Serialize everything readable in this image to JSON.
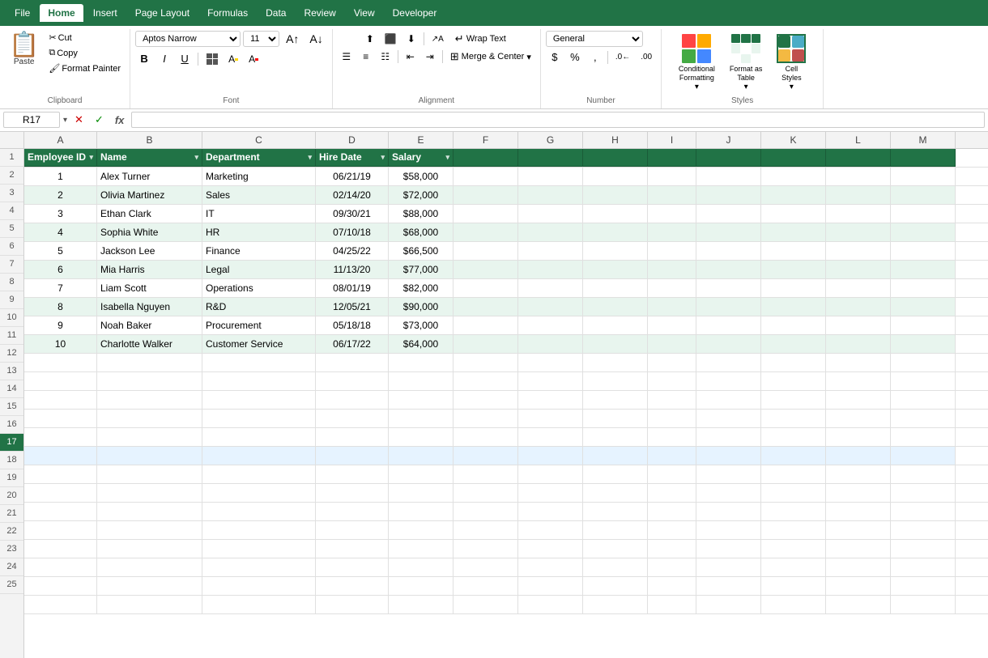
{
  "tabs": {
    "items": [
      {
        "label": "File",
        "active": false
      },
      {
        "label": "Home",
        "active": true
      },
      {
        "label": "Insert",
        "active": false
      },
      {
        "label": "Page Layout",
        "active": false
      },
      {
        "label": "Formulas",
        "active": false
      },
      {
        "label": "Data",
        "active": false
      },
      {
        "label": "Review",
        "active": false
      },
      {
        "label": "View",
        "active": false
      },
      {
        "label": "Developer",
        "active": false
      }
    ]
  },
  "ribbon": {
    "clipboard": {
      "group_label": "Clipboard",
      "paste_label": "Paste",
      "cut_label": "Cut",
      "copy_label": "Copy",
      "format_painter_label": "Format Painter"
    },
    "font": {
      "group_label": "Font",
      "font_name": "Aptos Narrow",
      "font_size": "11",
      "bold": "B",
      "italic": "I",
      "underline": "U",
      "borders": "⊞",
      "fill_color": "A",
      "font_color": "A"
    },
    "alignment": {
      "group_label": "Alignment",
      "wrap_text": "Wrap Text",
      "merge_center": "Merge & Center"
    },
    "number": {
      "group_label": "Number",
      "format": "General"
    },
    "styles": {
      "group_label": "Styles",
      "conditional_formatting": "Conditional Formatting",
      "format_as_table": "Format as Table",
      "cell_styles": "Cell Styles"
    }
  },
  "formula_bar": {
    "cell_ref": "R17",
    "formula": ""
  },
  "columns": {
    "headers": [
      "A",
      "B",
      "C",
      "D",
      "E",
      "F",
      "G",
      "H",
      "I",
      "J",
      "K",
      "L",
      "M"
    ],
    "labels": [
      "Employee ID",
      "Name",
      "Department",
      "Hire Date",
      "Salary",
      "",
      "",
      "",
      "",
      "",
      "",
      "",
      ""
    ]
  },
  "rows": [
    {
      "num": 1,
      "is_header": true,
      "cells": [
        "Employee ID",
        "Name",
        "Department",
        "Hire Date",
        "Salary",
        "",
        "",
        "",
        "",
        "",
        "",
        "",
        ""
      ]
    },
    {
      "num": 2,
      "alt": false,
      "cells": [
        "1",
        "Alex Turner",
        "Marketing",
        "06/21/19",
        "$58,000",
        "",
        "",
        "",
        "",
        "",
        "",
        "",
        ""
      ]
    },
    {
      "num": 3,
      "alt": true,
      "cells": [
        "2",
        "Olivia Martinez",
        "Sales",
        "02/14/20",
        "$72,000",
        "",
        "",
        "",
        "",
        "",
        "",
        "",
        ""
      ]
    },
    {
      "num": 4,
      "alt": false,
      "cells": [
        "3",
        "Ethan Clark",
        "IT",
        "09/30/21",
        "$88,000",
        "",
        "",
        "",
        "",
        "",
        "",
        "",
        ""
      ]
    },
    {
      "num": 5,
      "alt": true,
      "cells": [
        "4",
        "Sophia White",
        "HR",
        "07/10/18",
        "$68,000",
        "",
        "",
        "",
        "",
        "",
        "",
        "",
        ""
      ]
    },
    {
      "num": 6,
      "alt": false,
      "cells": [
        "5",
        "Jackson Lee",
        "Finance",
        "04/25/22",
        "$66,500",
        "",
        "",
        "",
        "",
        "",
        "",
        "",
        ""
      ]
    },
    {
      "num": 7,
      "alt": true,
      "cells": [
        "6",
        "Mia Harris",
        "Legal",
        "11/13/20",
        "$77,000",
        "",
        "",
        "",
        "",
        "",
        "",
        "",
        ""
      ]
    },
    {
      "num": 8,
      "alt": false,
      "cells": [
        "7",
        "Liam Scott",
        "Operations",
        "08/01/19",
        "$82,000",
        "",
        "",
        "",
        "",
        "",
        "",
        "",
        ""
      ]
    },
    {
      "num": 9,
      "alt": true,
      "cells": [
        "8",
        "Isabella Nguyen",
        "R&D",
        "12/05/21",
        "$90,000",
        "",
        "",
        "",
        "",
        "",
        "",
        "",
        ""
      ]
    },
    {
      "num": 10,
      "alt": false,
      "cells": [
        "9",
        "Noah Baker",
        "Procurement",
        "05/18/18",
        "$73,000",
        "",
        "",
        "",
        "",
        "",
        "",
        "",
        ""
      ]
    },
    {
      "num": 11,
      "alt": true,
      "cells": [
        "10",
        "Charlotte Walker",
        "Customer Service",
        "06/17/22",
        "$64,000",
        "",
        "",
        "",
        "",
        "",
        "",
        "",
        ""
      ]
    },
    {
      "num": 12,
      "alt": false,
      "cells": [
        "",
        "",
        "",
        "",
        "",
        "",
        "",
        "",
        "",
        "",
        "",
        "",
        ""
      ]
    },
    {
      "num": 13,
      "alt": false,
      "cells": [
        "",
        "",
        "",
        "",
        "",
        "",
        "",
        "",
        "",
        "",
        "",
        "",
        ""
      ]
    },
    {
      "num": 14,
      "alt": false,
      "cells": [
        "",
        "",
        "",
        "",
        "",
        "",
        "",
        "",
        "",
        "",
        "",
        "",
        ""
      ]
    },
    {
      "num": 15,
      "alt": false,
      "cells": [
        "",
        "",
        "",
        "",
        "",
        "",
        "",
        "",
        "",
        "",
        "",
        "",
        ""
      ]
    },
    {
      "num": 16,
      "alt": false,
      "cells": [
        "",
        "",
        "",
        "",
        "",
        "",
        "",
        "",
        "",
        "",
        "",
        "",
        ""
      ]
    },
    {
      "num": 17,
      "alt": false,
      "selected": true,
      "cells": [
        "",
        "",
        "",
        "",
        "",
        "",
        "",
        "",
        "",
        "",
        "",
        "",
        ""
      ]
    },
    {
      "num": 18,
      "alt": false,
      "cells": [
        "",
        "",
        "",
        "",
        "",
        "",
        "",
        "",
        "",
        "",
        "",
        "",
        ""
      ]
    },
    {
      "num": 19,
      "alt": false,
      "cells": [
        "",
        "",
        "",
        "",
        "",
        "",
        "",
        "",
        "",
        "",
        "",
        "",
        ""
      ]
    },
    {
      "num": 20,
      "alt": false,
      "cells": [
        "",
        "",
        "",
        "",
        "",
        "",
        "",
        "",
        "",
        "",
        "",
        "",
        ""
      ]
    },
    {
      "num": 21,
      "alt": false,
      "cells": [
        "",
        "",
        "",
        "",
        "",
        "",
        "",
        "",
        "",
        "",
        "",
        "",
        ""
      ]
    },
    {
      "num": 22,
      "alt": false,
      "cells": [
        "",
        "",
        "",
        "",
        "",
        "",
        "",
        "",
        "",
        "",
        "",
        "",
        ""
      ]
    },
    {
      "num": 23,
      "alt": false,
      "cells": [
        "",
        "",
        "",
        "",
        "",
        "",
        "",
        "",
        "",
        "",
        "",
        "",
        ""
      ]
    },
    {
      "num": 24,
      "alt": false,
      "cells": [
        "",
        "",
        "",
        "",
        "",
        "",
        "",
        "",
        "",
        "",
        "",
        "",
        ""
      ]
    },
    {
      "num": 25,
      "alt": false,
      "cells": [
        "",
        "",
        "",
        "",
        "",
        "",
        "",
        "",
        "",
        "",
        "",
        "",
        ""
      ]
    }
  ],
  "colors": {
    "excel_green": "#217346",
    "header_bg": "#217346",
    "header_text": "#ffffff",
    "alt_row": "#e8f5ee",
    "selected_row": "#e6f3ff"
  }
}
